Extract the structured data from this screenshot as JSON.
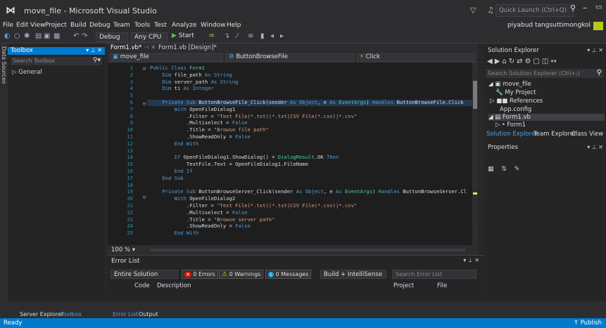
{
  "window": {
    "title": "move_file - Microsoft Visual Studio",
    "quick_launch_placeholder": "Quick Launch (Ctrl+Q)"
  },
  "menu": {
    "items": [
      "File",
      "Edit",
      "View",
      "Project",
      "Build",
      "Debug",
      "Team",
      "Tools",
      "Test",
      "Analyze",
      "Window",
      "Help"
    ],
    "user": "piyabud tangsuttimongkol"
  },
  "toolbar": {
    "config": "Debug",
    "platform": "Any CPU",
    "start_label": "Start"
  },
  "side_strip": {
    "tabs": [
      "Data Sources",
      "Toolbox"
    ]
  },
  "toolbox": {
    "title": "Toolbox",
    "search_placeholder": "Search Toolbox",
    "group": "▷ General"
  },
  "editor_tabs": [
    {
      "label": "Form1.vb*"
    },
    {
      "label": "Form1.vb [Design]*"
    }
  ],
  "navbar": {
    "project": "move_file",
    "member": "ButtonBrowseFile",
    "event": "Click"
  },
  "code_lines": [
    {
      "n": "1",
      "tokens": [
        [
          "kw",
          "Public Class "
        ],
        [
          "ty",
          "Form1"
        ]
      ]
    },
    {
      "n": "2",
      "tokens": [
        [
          "",
          "    "
        ],
        [
          "kw",
          "Dim "
        ],
        [
          "",
          "file_path "
        ],
        [
          "kw",
          "As String"
        ]
      ]
    },
    {
      "n": "3",
      "tokens": [
        [
          "",
          "    "
        ],
        [
          "kw",
          "Dim "
        ],
        [
          "",
          "server_path "
        ],
        [
          "kw",
          "As String"
        ]
      ]
    },
    {
      "n": "4",
      "tokens": [
        [
          "",
          "    "
        ],
        [
          "kw",
          "Dim "
        ],
        [
          "",
          "ti "
        ],
        [
          "kw",
          "As Integer"
        ]
      ]
    },
    {
      "n": "5",
      "tokens": [
        [
          "",
          ""
        ]
      ]
    },
    {
      "n": "6",
      "tokens": [
        [
          "",
          "    "
        ],
        [
          "kw",
          "Private Sub "
        ],
        [
          "",
          "ButtonBrowseFile_Click(sender "
        ],
        [
          "kw",
          "As "
        ],
        [
          "kw",
          "Object"
        ],
        [
          "",
          ", e "
        ],
        [
          "kw",
          "As "
        ],
        [
          "ty",
          "EventArgs"
        ],
        [
          "",
          ") "
        ],
        [
          "kw",
          "Handles "
        ],
        [
          "",
          "ButtonBrowseFile.Click"
        ]
      ]
    },
    {
      "n": "7",
      "tokens": [
        [
          "",
          "        "
        ],
        [
          "kw",
          "With "
        ],
        [
          "",
          "OpenFileDialog1"
        ]
      ]
    },
    {
      "n": "8",
      "tokens": [
        [
          "",
          "            .Filter = "
        ],
        [
          "str",
          "\"Text File(*.txt)|*.txt|CSV File(*.csv)|*.csv\""
        ]
      ]
    },
    {
      "n": "9",
      "tokens": [
        [
          "",
          "            .Multiselect = "
        ],
        [
          "kw",
          "False"
        ]
      ]
    },
    {
      "n": "10",
      "tokens": [
        [
          "",
          "            .Title = "
        ],
        [
          "str",
          "\"Browse file path\""
        ]
      ]
    },
    {
      "n": "11",
      "tokens": [
        [
          "",
          "            .ShowReadOnly = "
        ],
        [
          "kw",
          "False"
        ]
      ]
    },
    {
      "n": "12",
      "tokens": [
        [
          "",
          "        "
        ],
        [
          "kw",
          "End With"
        ]
      ]
    },
    {
      "n": "13",
      "tokens": [
        [
          "",
          ""
        ]
      ]
    },
    {
      "n": "14",
      "tokens": [
        [
          "",
          "        "
        ],
        [
          "kw",
          "If "
        ],
        [
          "",
          "OpenFileDialog1.ShowDialog() = "
        ],
        [
          "ty",
          "DialogResult"
        ],
        [
          "",
          ".OK "
        ],
        [
          "kw",
          "Then"
        ]
      ]
    },
    {
      "n": "15",
      "tokens": [
        [
          "",
          "            TextFile.Text = OpenFileDialog1.FileName"
        ]
      ]
    },
    {
      "n": "16",
      "tokens": [
        [
          "",
          "        "
        ],
        [
          "kw",
          "End If"
        ]
      ]
    },
    {
      "n": "17",
      "tokens": [
        [
          "",
          "    "
        ],
        [
          "kw",
          "End Sub"
        ]
      ]
    },
    {
      "n": "18",
      "tokens": [
        [
          "",
          ""
        ]
      ]
    },
    {
      "n": "19",
      "tokens": [
        [
          "",
          "    "
        ],
        [
          "kw",
          "Private Sub "
        ],
        [
          "",
          "ButtonBrowseServer_Click(sender "
        ],
        [
          "kw",
          "As "
        ],
        [
          "kw",
          "Object"
        ],
        [
          "",
          ", e "
        ],
        [
          "kw",
          "As "
        ],
        [
          "ty",
          "EventArgs"
        ],
        [
          "",
          ") "
        ],
        [
          "kw",
          "Handles "
        ],
        [
          "",
          "ButtonBrowseServer.Cl"
        ]
      ]
    },
    {
      "n": "20",
      "tokens": [
        [
          "",
          "        "
        ],
        [
          "kw",
          "With "
        ],
        [
          "",
          "OpenFileDialog2"
        ]
      ]
    },
    {
      "n": "21",
      "tokens": [
        [
          "",
          "            .Filter = "
        ],
        [
          "str",
          "\"Text File(*.txt)|*.txt|CSV File(*.csv)|*.csv\""
        ]
      ]
    },
    {
      "n": "22",
      "tokens": [
        [
          "",
          "            .Multiselect = "
        ],
        [
          "kw",
          "False"
        ]
      ]
    },
    {
      "n": "23",
      "tokens": [
        [
          "",
          "            .Title = "
        ],
        [
          "str",
          "\"Browse server path\""
        ]
      ]
    },
    {
      "n": "24",
      "tokens": [
        [
          "",
          "            .ShowReadOnly = "
        ],
        [
          "kw",
          "False"
        ]
      ]
    },
    {
      "n": "25",
      "tokens": [
        [
          "",
          "        "
        ],
        [
          "kw",
          "End With"
        ]
      ]
    }
  ],
  "editor": {
    "zoom": "100 %"
  },
  "error_list": {
    "title": "Error List",
    "scope": "Entire Solution",
    "errors": "0 Errors",
    "warnings": "0 Warnings",
    "messages": "0 Messages",
    "build": "Build + IntelliSense",
    "search_placeholder": "Search Error List",
    "columns": [
      "Code",
      "Description",
      "Project",
      "File"
    ]
  },
  "solution_explorer": {
    "title": "Solution Explorer",
    "search_placeholder": "Search Solution Explorer (Ctrl+;)",
    "nodes": [
      {
        "label": "◢ ▣ move_file"
      },
      {
        "label": "🔧 My Project"
      },
      {
        "label": "▷ ■■ References"
      },
      {
        "label": "App.config"
      },
      {
        "label": "◢ ▤ Form1.vb"
      },
      {
        "label": "▷ ⁍ Form1"
      }
    ],
    "tabs": [
      "Solution Explorer",
      "Team Explorer",
      "Class View"
    ]
  },
  "properties": {
    "title": "Properties"
  },
  "bottom_tabs": {
    "left": [
      "Server Explorer",
      "Toolbox"
    ],
    "center": [
      "Error List",
      "Output"
    ]
  },
  "status": {
    "left": "Ready",
    "right": "↑ Publish"
  }
}
